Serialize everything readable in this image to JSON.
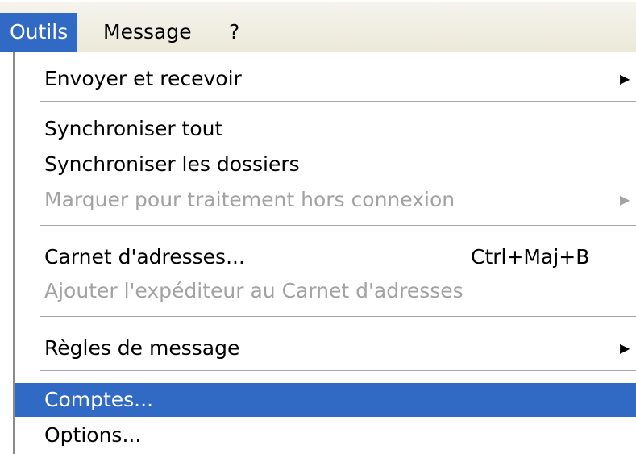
{
  "menubar": {
    "items": [
      {
        "label": "Outils"
      },
      {
        "label": "Message"
      },
      {
        "label": "?"
      }
    ]
  },
  "menu": {
    "items": [
      {
        "label": "Envoyer et recevoir",
        "submenu_arrow": "▶"
      },
      {
        "label": "Synchroniser tout"
      },
      {
        "label": "Synchroniser les dossiers"
      },
      {
        "label": "Marquer pour traitement hors connexion",
        "submenu_arrow": "▶"
      },
      {
        "label": "Carnet d'adresses...",
        "shortcut": "Ctrl+Maj+B"
      },
      {
        "label": "Ajouter l'expéditeur au Carnet d'adresses"
      },
      {
        "label": "Règles de message",
        "submenu_arrow": "▶"
      },
      {
        "label": "Comptes..."
      },
      {
        "label": "Options..."
      }
    ]
  },
  "colors": {
    "highlight": "#316ac5",
    "disabled_text": "#a2a2a2",
    "menubar_bg": "#ece9d8"
  },
  "icons": {
    "submenu": "triangle-right-icon"
  }
}
